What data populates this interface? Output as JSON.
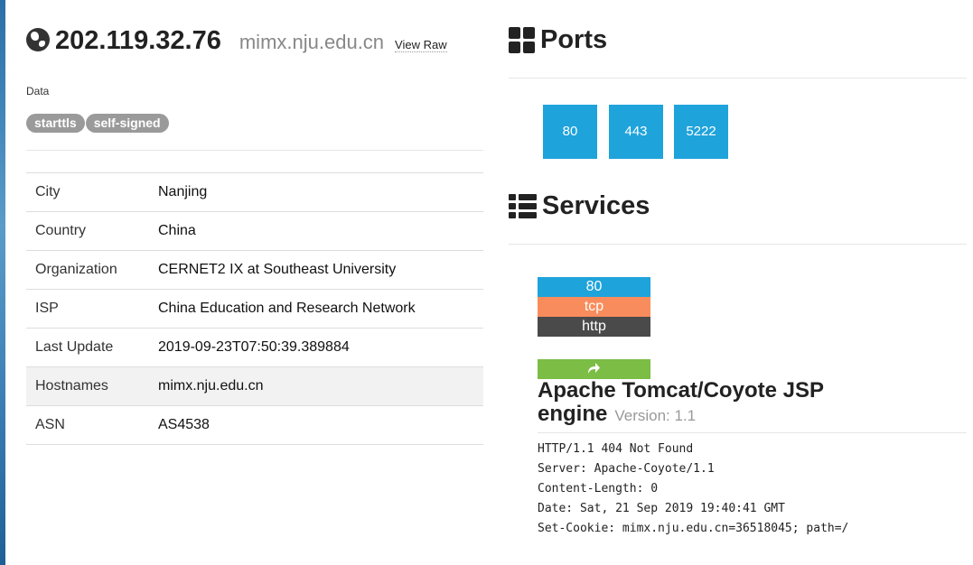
{
  "header": {
    "ip": "202.119.32.76",
    "hostname": "mimx.nju.edu.cn",
    "view_raw": "View Raw"
  },
  "data_label": "Data",
  "tags": [
    "starttls",
    "self-signed"
  ],
  "info_rows": [
    {
      "key": "City",
      "value": "Nanjing"
    },
    {
      "key": "Country",
      "value": "China"
    },
    {
      "key": "Organization",
      "value": "CERNET2 IX at Southeast University"
    },
    {
      "key": "ISP",
      "value": "China Education and Research Network"
    },
    {
      "key": "Last Update",
      "value": "2019-09-23T07:50:39.389884"
    },
    {
      "key": "Hostnames",
      "value": "mimx.nju.edu.cn"
    },
    {
      "key": "ASN",
      "value": "AS4538"
    }
  ],
  "ports": {
    "title": "Ports",
    "list": [
      "80",
      "443",
      "5222"
    ]
  },
  "services": {
    "title": "Services",
    "port": "80",
    "transport": "tcp",
    "protocol": "http",
    "product": "Apache Tomcat/Coyote JSP engine",
    "version": "Version: 1.1",
    "banner": [
      "HTTP/1.1 404 Not Found",
      "Server: Apache-Coyote/1.1",
      "Content-Length: 0",
      "Date: Sat, 21 Sep 2019 19:40:41 GMT",
      "Set-Cookie: mimx.nju.edu.cn=36518045; path=/"
    ]
  },
  "colors": {
    "port_blue": "#1fa3db",
    "tcp_orange": "#f98c5c",
    "http_dark": "#4a4a4a",
    "link_green": "#7bbd45",
    "tag_gray": "#9a9a9a"
  },
  "icons": [
    "globe-icon",
    "grid-icon",
    "list-icon",
    "share-arrow-icon"
  ]
}
